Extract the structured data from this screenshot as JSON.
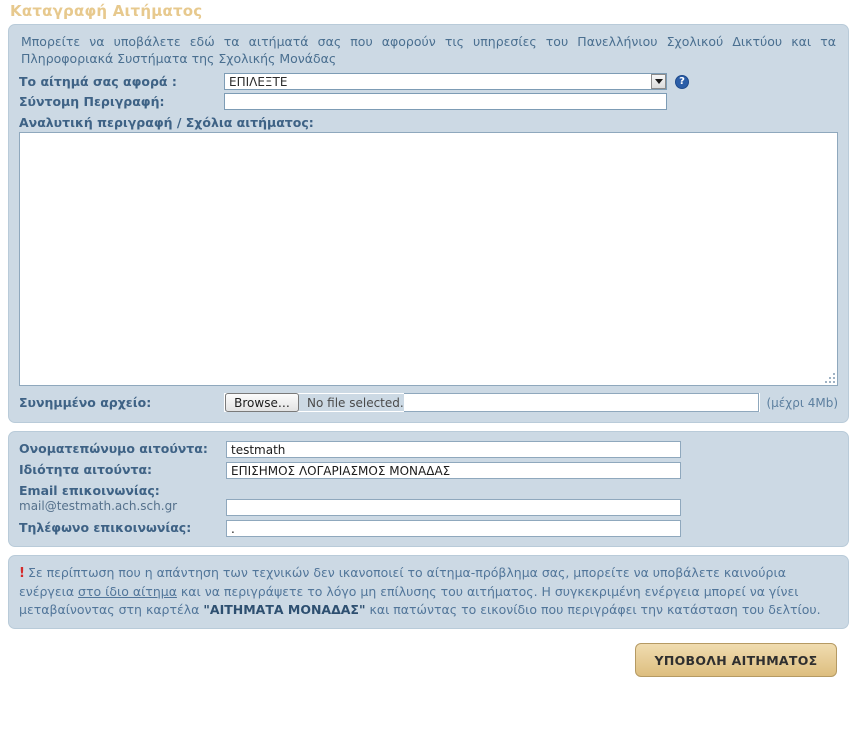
{
  "page": {
    "title": "Καταγραφή Αιτήματος"
  },
  "form": {
    "intro": "Μπορείτε να υποβάλετε εδώ τα αιτήματά σας που αφορούν τις υπηρεσίες του Πανελλήνιου Σχολικού Δικτύου και τα Πληροφοριακά Συστήματα της Σχολικής Μονάδας",
    "category": {
      "label": "Το αίτημά σας αφορά :",
      "selected": "ΕΠΙΛΕΞΤΕ",
      "help_icon": "help-circle-icon",
      "dropdown_icon": "chevron-down-icon"
    },
    "short_description": {
      "label": "Σύντομη Περιγραφή:",
      "value": "",
      "placeholder": ""
    },
    "detail": {
      "label": "Αναλυτική περιγραφή / Σχόλια αιτήματος:",
      "value": "",
      "placeholder": ""
    },
    "attachment": {
      "label": "Συνημμένο αρχείο:",
      "browse_label": "Browse…",
      "no_file_text": "No file selected.",
      "size_hint": "(μέχρι 4Mb)"
    }
  },
  "contact": {
    "fullname": {
      "label": "Ονοματεπώνυμο αιτούντα:",
      "value": "testmath"
    },
    "role": {
      "label": "Ιδιότητα αιτούντα:",
      "value": "ΕΠΙΣΗΜΟΣ ΛΟΓΑΡΙΑΣΜΟΣ ΜΟΝΑΔΑΣ"
    },
    "email": {
      "label": "Email επικοινωνίας:",
      "sublabel": "mail@testmath.ach.sch.gr",
      "value": ""
    },
    "phone": {
      "label": "Τηλέφωνο επικοινωνίας:",
      "value": "."
    }
  },
  "notice": {
    "icon": "warning-exclamation-icon",
    "part1": "Σε περίπτωση που η απάντηση των τεχνικών δεν ικανοποιεί το αίτημα-πρόβλημα σας, μπορείτε να υποβάλετε καινούρια ενέργεια ",
    "link": "στο ίδιο αίτημα",
    "part2": " και να περιγράψετε το λόγο μη επίλυσης του αιτήματος. Η συγκεκριμένη ενέργεια μπορεί να γίνει μεταβαίνοντας στη καρτέλα ",
    "bold": "\"ΑΙΤΗΜΑΤΑ ΜΟΝΑΔΑΣ\"",
    "part3": " και πατώντας το εικονίδιο που περιγράφει την κατάσταση του δελτίου."
  },
  "actions": {
    "submit_label": "ΥΠΟΒΟΛΗ ΑΙΤΗΜΑΤΟΣ"
  }
}
